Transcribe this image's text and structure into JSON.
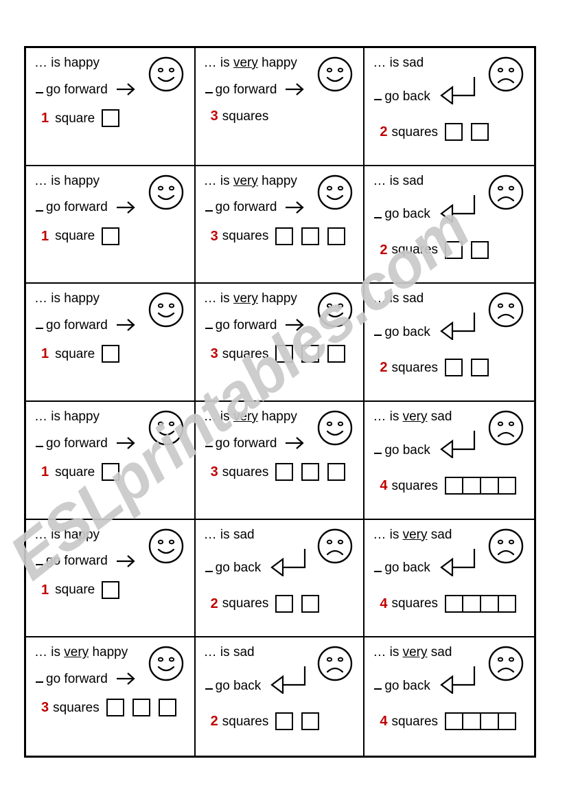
{
  "watermark": {
    "text": "ESLprintables.com"
  },
  "colors": {
    "count": "#c00000",
    "ink": "#000000",
    "watermark": "#c9c9c9"
  },
  "labels": {
    "ellipsis": "… is",
    "very": "very",
    "happy": "happy",
    "sad": "sad",
    "go_forward": "go forward",
    "go_back": "go back",
    "square": "square",
    "squares": "squares"
  },
  "cards": [
    {
      "id": "r1c1",
      "mood_prefix": "… is",
      "very": "",
      "mood": "happy",
      "face": "happy-face",
      "direction": "go forward",
      "arrow": "forward-arrow",
      "count": "1",
      "unit": "square",
      "boxes": 1,
      "boxes_style": "gap"
    },
    {
      "id": "r1c2",
      "mood_prefix": "… is",
      "very": "very",
      "mood": "happy",
      "face": "happy-face",
      "direction": "go forward",
      "arrow": "forward-arrow",
      "count": "3",
      "unit": "squares",
      "boxes": 0,
      "boxes_style": "gap"
    },
    {
      "id": "r1c3",
      "mood_prefix": "… is",
      "very": "",
      "mood": "sad",
      "face": "sad-face",
      "direction": "go back",
      "arrow": "back-arrow",
      "count": "2",
      "unit": "squares",
      "boxes": 2,
      "boxes_style": "gap"
    },
    {
      "id": "r2c1",
      "mood_prefix": "… is",
      "very": "",
      "mood": "happy",
      "face": "happy-face",
      "direction": "go forward",
      "arrow": "forward-arrow",
      "count": "1",
      "unit": "square",
      "boxes": 1,
      "boxes_style": "gap"
    },
    {
      "id": "r2c2",
      "mood_prefix": "… is",
      "very": "very",
      "mood": "happy",
      "face": "happy-face",
      "direction": "go forward",
      "arrow": "forward-arrow",
      "count": "3",
      "unit": "squares",
      "boxes": 3,
      "boxes_style": "gap"
    },
    {
      "id": "r2c3",
      "mood_prefix": "… is",
      "very": "",
      "mood": "sad",
      "face": "sad-face",
      "direction": "go back",
      "arrow": "back-arrow",
      "count": "2",
      "unit": "squares",
      "boxes": 2,
      "boxes_style": "gap"
    },
    {
      "id": "r3c1",
      "mood_prefix": "… is",
      "very": "",
      "mood": "happy",
      "face": "happy-face",
      "direction": "go forward",
      "arrow": "forward-arrow",
      "count": "1",
      "unit": "square",
      "boxes": 1,
      "boxes_style": "gap"
    },
    {
      "id": "r3c2",
      "mood_prefix": "… is",
      "very": "very",
      "mood": "happy",
      "face": "happy-face",
      "direction": "go forward",
      "arrow": "forward-arrow",
      "count": "3",
      "unit": "squares",
      "boxes": 3,
      "boxes_style": "gap"
    },
    {
      "id": "r3c3",
      "mood_prefix": "… is",
      "very": "",
      "mood": "sad",
      "face": "sad-face",
      "direction": "go back",
      "arrow": "back-arrow",
      "count": "2",
      "unit": "squares",
      "boxes": 2,
      "boxes_style": "gap"
    },
    {
      "id": "r4c1",
      "mood_prefix": "… is",
      "very": "",
      "mood": "happy",
      "face": "happy-face",
      "direction": "go forward",
      "arrow": "forward-arrow",
      "count": "1",
      "unit": "square",
      "boxes": 1,
      "boxes_style": "gap"
    },
    {
      "id": "r4c2",
      "mood_prefix": "… is",
      "very": "very",
      "mood": "happy",
      "face": "happy-face",
      "direction": "go forward",
      "arrow": "forward-arrow",
      "count": "3",
      "unit": "squares",
      "boxes": 3,
      "boxes_style": "gap"
    },
    {
      "id": "r4c3",
      "mood_prefix": "… is",
      "very": "very",
      "mood": "sad",
      "face": "sad-face",
      "direction": "go back",
      "arrow": "back-arrow",
      "count": "4",
      "unit": "squares",
      "boxes": 4,
      "boxes_style": "joined"
    },
    {
      "id": "r5c1",
      "mood_prefix": "… is",
      "very": "",
      "mood": "happy",
      "face": "happy-face",
      "direction": "go forward",
      "arrow": "forward-arrow",
      "count": "1",
      "unit": "square",
      "boxes": 1,
      "boxes_style": "gap"
    },
    {
      "id": "r5c2",
      "mood_prefix": "… is",
      "very": "",
      "mood": "sad",
      "face": "sad-face",
      "direction": "go back",
      "arrow": "back-arrow",
      "count": "2",
      "unit": "squares",
      "boxes": 2,
      "boxes_style": "gap"
    },
    {
      "id": "r5c3",
      "mood_prefix": "… is",
      "very": "very",
      "mood": "sad",
      "face": "sad-face",
      "direction": "go back",
      "arrow": "back-arrow",
      "count": "4",
      "unit": "squares",
      "boxes": 4,
      "boxes_style": "joined"
    },
    {
      "id": "r6c1",
      "mood_prefix": "… is",
      "very": "very",
      "mood": "happy",
      "face": "happy-face",
      "direction": "go forward",
      "arrow": "forward-arrow",
      "count": "3",
      "unit": "squares",
      "boxes": 3,
      "boxes_style": "gap"
    },
    {
      "id": "r6c2",
      "mood_prefix": "… is",
      "very": "",
      "mood": "sad",
      "face": "sad-face",
      "direction": "go back",
      "arrow": "back-arrow",
      "count": "2",
      "unit": "squares",
      "boxes": 2,
      "boxes_style": "gap"
    },
    {
      "id": "r6c3",
      "mood_prefix": "… is",
      "very": "very",
      "mood": "sad",
      "face": "sad-face",
      "direction": "go back",
      "arrow": "back-arrow",
      "count": "4",
      "unit": "squares",
      "boxes": 4,
      "boxes_style": "joined"
    }
  ]
}
